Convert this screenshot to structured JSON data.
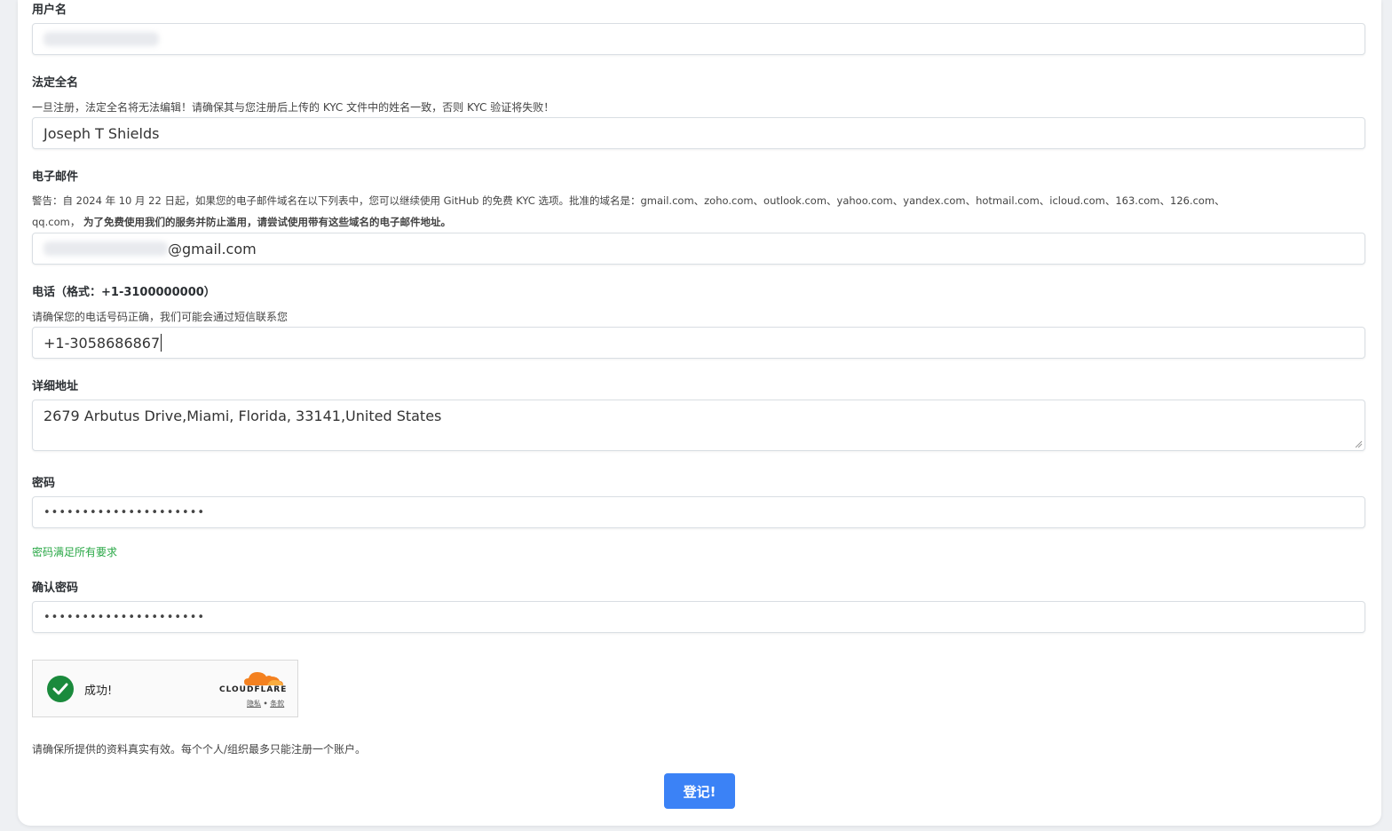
{
  "username": {
    "label": "用户名"
  },
  "legal_name": {
    "label": "法定全名",
    "help": "一旦注册，法定全名将无法编辑！请确保其与您注册后上传的 KYC 文件中的姓名一致，否则 KYC 验证将失败！",
    "value": "Joseph T Shields"
  },
  "email": {
    "label": "电子邮件",
    "warning_line1": "警告：自 2024 年 10 月 22 日起，如果您的电子邮件域名在以下列表中，您可以继续使用 GitHub 的免费 KYC 选项。批准的域名是：gmail.com、zoho.com、outlook.com、yahoo.com、yandex.com、hotmail.com、icloud.com、163.com、126.com、",
    "warning_line2_normal": "qq.com，",
    "warning_line2_bold": "为了免费使用我们的服务并防止滥用，请尝试使用带有这些域名的电子邮件地址。",
    "value_suffix": "@gmail.com"
  },
  "phone": {
    "label": "电话（格式：+1-3100000000）",
    "help": "请确保您的电话号码正确，我们可能会通过短信联系您",
    "value": "+1-3058686867"
  },
  "address": {
    "label": "详细地址",
    "value": "2679 Arbutus Drive,Miami, Florida, 33141,United States"
  },
  "password": {
    "label": "密码",
    "masked": "•••••••••••••••••••••",
    "status": "密码满足所有要求"
  },
  "confirm_password": {
    "label": "确认密码",
    "masked": "•••••••••••••••••••••"
  },
  "captcha": {
    "status": "成功!",
    "brand": "CLOUDFLARE",
    "privacy": "隐私",
    "separator": "•",
    "terms": "条款"
  },
  "note": "请确保所提供的资料真实有效。每个个人/组织最多只能注册一个账户。",
  "submit_label": "登记!",
  "colors": {
    "accent": "#3b82f6",
    "success": "#28a745",
    "cloudflare_orange": "#f48120"
  }
}
